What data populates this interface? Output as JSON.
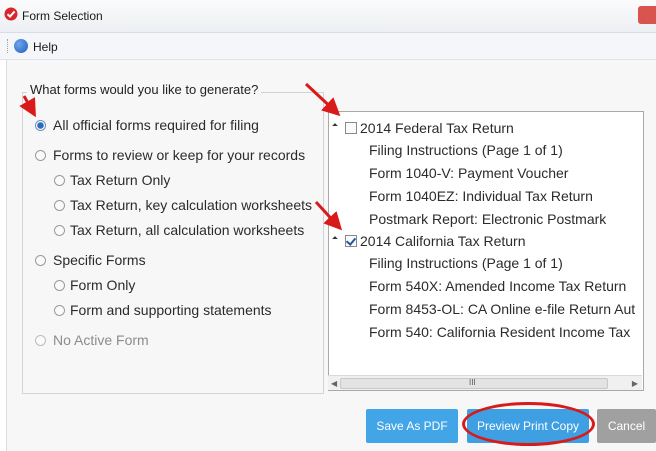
{
  "window": {
    "title": "Form Selection",
    "menu_help": "Help"
  },
  "prompt": "What forms would you like to generate?",
  "options": [
    {
      "label": "All official forms required for filing",
      "selected": true,
      "enabled": true
    },
    {
      "label": "Forms to review or keep for your records",
      "selected": false,
      "enabled": true
    },
    {
      "label": "Tax Return Only",
      "selected": false,
      "enabled": true
    },
    {
      "label": "Tax Return, key calculation worksheets",
      "selected": false,
      "enabled": true
    },
    {
      "label": "Tax Return, all calculation worksheets",
      "selected": false,
      "enabled": true
    },
    {
      "label": "Specific Forms",
      "selected": false,
      "enabled": true
    },
    {
      "label": "Form Only",
      "selected": false,
      "enabled": true
    },
    {
      "label": "Form and supporting statements",
      "selected": false,
      "enabled": true
    },
    {
      "label": "No Active Form",
      "selected": false,
      "enabled": false
    }
  ],
  "tree": {
    "federal": {
      "label": "2014 Federal Tax Return",
      "checked": false,
      "children": [
        "Filing Instructions (Page 1 of 1)",
        "Form 1040-V: Payment Voucher",
        "Form 1040EZ: Individual Tax Return",
        "Postmark Report: Electronic Postmark"
      ]
    },
    "california": {
      "label": "2014 California Tax Return",
      "checked": true,
      "children": [
        "Filing Instructions (Page 1 of 1)",
        "Form 540X: Amended Income Tax Return",
        "Form 8453-OL: CA Online e-file Return Aut",
        "Form 540: California Resident Income Tax"
      ]
    },
    "scroll_grip": "III"
  },
  "buttons": {
    "save_pdf": "Save As PDF",
    "preview": "Preview Print Copy",
    "cancel": "Cancel"
  },
  "colors": {
    "accent_button": "#42a5e8",
    "annotation_red": "#d91a1a"
  }
}
